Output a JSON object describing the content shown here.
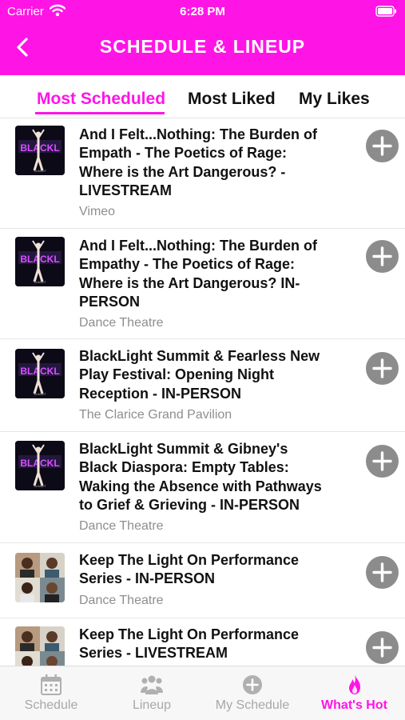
{
  "status_bar": {
    "carrier": "Carrier",
    "time": "6:28 PM"
  },
  "header": {
    "title": "SCHEDULE & LINEUP",
    "back_icon": "chevron-left-icon"
  },
  "tabs": [
    {
      "label": "Most Scheduled",
      "active": true
    },
    {
      "label": "Most Liked",
      "active": false
    },
    {
      "label": "My Likes",
      "active": false
    }
  ],
  "events": [
    {
      "title_lines": [
        "And I Felt...Nothing: The Burden of",
        "Empath - The Poetics of Rage:",
        "Where is the Art Dangerous? -",
        "LIVESTREAM"
      ],
      "venue": "Vimeo",
      "thumbnail": "blacklight-dancer"
    },
    {
      "title_lines": [
        "And I Felt...Nothing: The Burden of",
        "Empathy - The Poetics of Rage:",
        "Where is the Art Dangerous? IN-",
        "PERSON"
      ],
      "venue": "Dance Theatre",
      "thumbnail": "blacklight-dancer"
    },
    {
      "title_lines": [
        "BlackLight Summit & Fearless New",
        "Play Festival: Opening Night",
        "Reception - IN-PERSON"
      ],
      "venue": "The Clarice Grand Pavilion",
      "thumbnail": "blacklight-dancer"
    },
    {
      "title_lines": [
        "BlackLight Summit & Gibney's",
        "Black Diaspora: Empty Tables:",
        "Waking the Absence with Pathways",
        "to Grief & Grieving - IN-PERSON"
      ],
      "venue": "Dance Theatre",
      "thumbnail": "blacklight-dancer"
    },
    {
      "title_lines": [
        "Keep The Light On Performance",
        "Series - IN-PERSON"
      ],
      "venue": "Dance Theatre",
      "thumbnail": "performer-collage"
    },
    {
      "title_lines": [
        "Keep The Light On Performance",
        "Series - LIVESTREAM"
      ],
      "venue": "",
      "thumbnail": "performer-collage"
    }
  ],
  "add_icon": "plus-circle-icon",
  "tabbar": [
    {
      "label": "Schedule",
      "icon": "calendar-icon",
      "active": false
    },
    {
      "label": "Lineup",
      "icon": "group-icon",
      "active": false
    },
    {
      "label": "My Schedule",
      "icon": "plus-circle-icon",
      "active": false
    },
    {
      "label": "What's Hot",
      "icon": "flame-icon",
      "active": true
    }
  ],
  "colors": {
    "accent": "#FF14E6",
    "inactive": "#A8A8A8",
    "add_button": "#8C8C8C"
  }
}
